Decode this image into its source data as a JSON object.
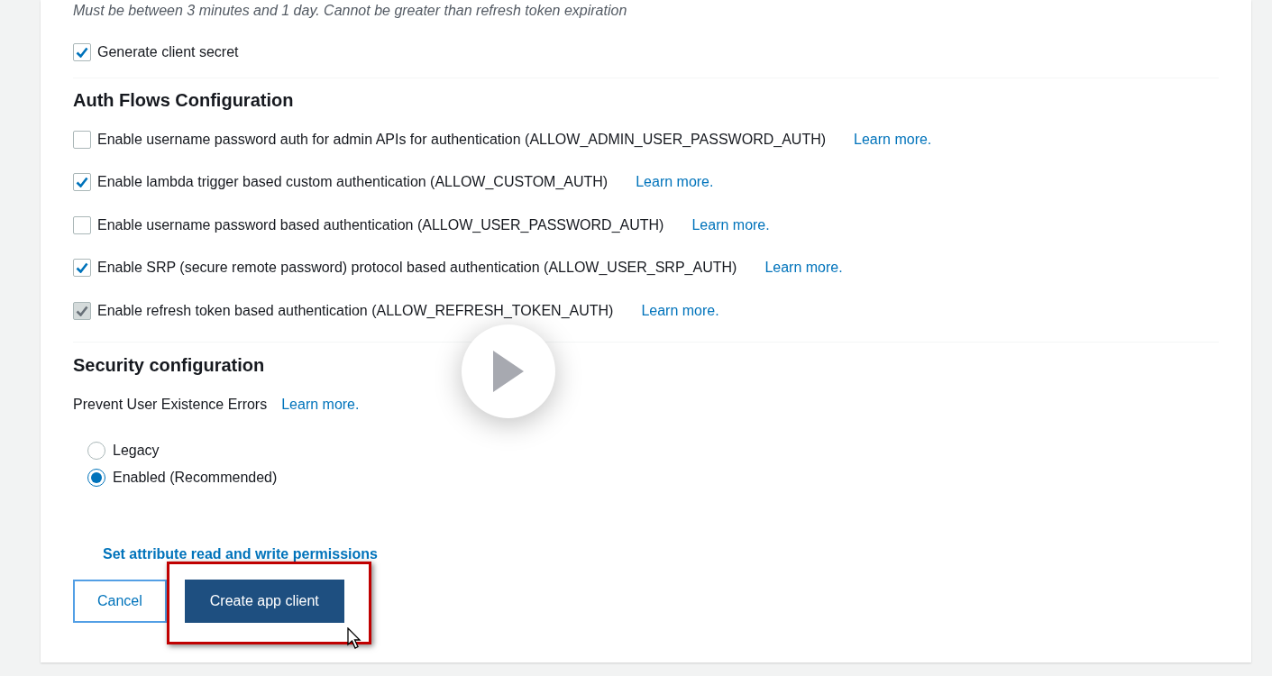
{
  "hint": "Must be between 3 minutes and 1 day. Cannot be greater than refresh token expiration",
  "generate_secret": {
    "label": "Generate client secret",
    "checked": true
  },
  "auth_flows": {
    "title": "Auth Flows Configuration",
    "items": [
      {
        "label": "Enable username password auth for admin APIs for authentication (ALLOW_ADMIN_USER_PASSWORD_AUTH)",
        "checked": false,
        "disabled": false,
        "link": "Learn more."
      },
      {
        "label": "Enable lambda trigger based custom authentication (ALLOW_CUSTOM_AUTH)",
        "checked": true,
        "disabled": false,
        "link": "Learn more."
      },
      {
        "label": "Enable username password based authentication (ALLOW_USER_PASSWORD_AUTH)",
        "checked": false,
        "disabled": false,
        "link": "Learn more."
      },
      {
        "label": "Enable SRP (secure remote password) protocol based authentication (ALLOW_USER_SRP_AUTH)",
        "checked": true,
        "disabled": false,
        "link": "Learn more."
      },
      {
        "label": "Enable refresh token based authentication (ALLOW_REFRESH_TOKEN_AUTH)",
        "checked": true,
        "disabled": true,
        "link": "Learn more."
      }
    ]
  },
  "security": {
    "title": "Security configuration",
    "label": "Prevent User Existence Errors",
    "link": "Learn more.",
    "options": [
      {
        "label": "Legacy",
        "selected": false
      },
      {
        "label": "Enabled (Recommended)",
        "selected": true
      }
    ]
  },
  "permissions_link": "Set attribute read and write permissions",
  "buttons": [
    {
      "label": "Cancel",
      "kind": "secondary"
    },
    {
      "label": "Create app client",
      "kind": "primary",
      "highlighted": true
    }
  ]
}
